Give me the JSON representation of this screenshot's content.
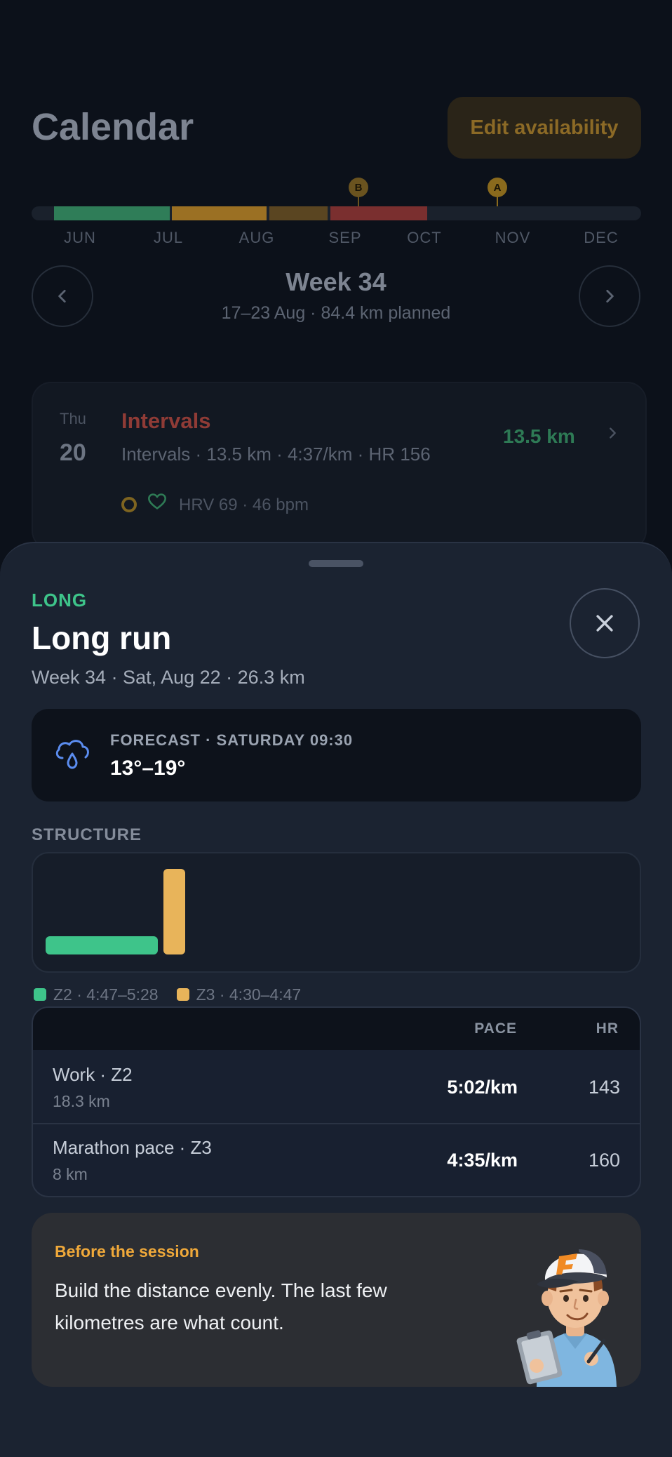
{
  "header": {
    "title": "Calendar",
    "edit_label": "Edit availability"
  },
  "season": {
    "races": [
      {
        "label": "B"
      },
      {
        "label": "A"
      }
    ],
    "months": [
      "JUN",
      "JUL",
      "AUG",
      "SEP",
      "OCT",
      "NOV",
      "DEC"
    ],
    "colors": {
      "base": "#2f7d58",
      "build": "#9b7023",
      "peak": "#5a4521",
      "taper": "#7a2f2f",
      "race_b": "#6a531f",
      "race_a": "#8a6a1d"
    }
  },
  "week": {
    "title": "Week 34",
    "subtitle": "17–23 Aug · 84.4 km planned",
    "prev_icon": "chevron-left-icon",
    "next_icon": "chevron-right-icon"
  },
  "day": {
    "dow": "Thu",
    "num": "20",
    "name": "Intervals",
    "meta": "Intervals · 13.5 km · 4:37/km · HR 156",
    "distance": "13.5 km",
    "hrv": "HRV 69 · 46 bpm"
  },
  "sheet": {
    "type": "LONG",
    "title": "Long run",
    "subtitle": "Week 34 · Sat, Aug 22 · 26.3 km",
    "forecast_label": "FORECAST · SATURDAY 09:30",
    "forecast_temp": "13°–19°",
    "forecast_icon": "rain-cloud-icon",
    "structure_label": "STRUCTURE",
    "structure": {
      "blocks": [
        {
          "zone": "Z2",
          "distance_km": 18.3,
          "color": "#3ec48a"
        },
        {
          "zone": "Z3",
          "distance_km": 8,
          "color": "#e8b45a"
        }
      ]
    },
    "legend": [
      {
        "label": "Z2 · 4:47–5:28",
        "color": "#3ec48a"
      },
      {
        "label": "Z3 · 4:30–4:47",
        "color": "#e8b45a"
      }
    ],
    "table": {
      "headers": {
        "pace": "PACE",
        "hr": "HR"
      },
      "rows": [
        {
          "name": "Work · Z2",
          "distance": "18.3 km",
          "pace": "5:02/km",
          "hr": "143"
        },
        {
          "name": "Marathon pace · Z3",
          "distance": "8 km",
          "pace": "4:35/km",
          "hr": "160"
        }
      ]
    },
    "coach": {
      "label": "Before the session",
      "text": "Build the distance evenly. The last few kilometres are what count."
    }
  }
}
